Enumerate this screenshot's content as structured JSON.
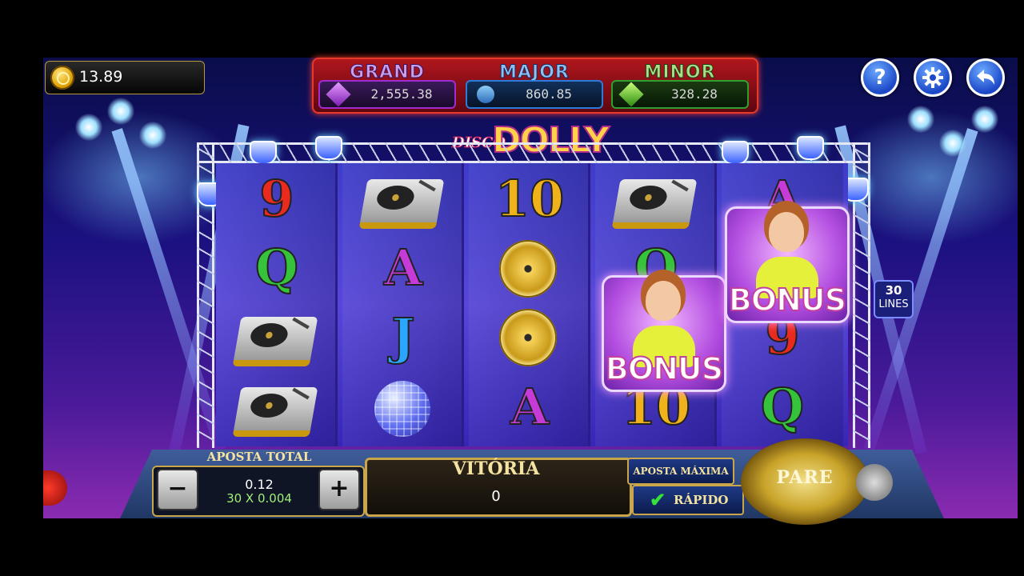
{
  "balance": {
    "value": "13.89",
    "icon": "gold-coin-icon"
  },
  "jackpots": [
    {
      "name": "GRAND",
      "value": "2,555.38",
      "color": "#a22bd0",
      "gem": "purple-gem-icon"
    },
    {
      "name": "MAJOR",
      "value": "860.85",
      "color": "#2b7bd8",
      "gem": "blue-gem-icon"
    },
    {
      "name": "MINOR",
      "value": "328.28",
      "color": "#2fa02f",
      "gem": "green-gem-icon"
    }
  ],
  "header_buttons": {
    "help": "?",
    "settings_icon": "gear-icon",
    "back_icon": "back-arrow-icon"
  },
  "logo": {
    "small": "DISCO",
    "big": "DOLLY"
  },
  "lines": {
    "count": "30",
    "label": "LINES"
  },
  "reels": [
    [
      "9",
      "Q",
      "turntable",
      "turntable"
    ],
    [
      "turntable",
      "A",
      "J",
      "disco-ball"
    ],
    [
      "10",
      "gold-disc",
      "gold-disc",
      "A"
    ],
    [
      "turntable",
      "Q",
      "bonus",
      "10"
    ],
    [
      "A",
      "bonus",
      "9",
      "Q"
    ]
  ],
  "bonus_label": "BONUS",
  "bet": {
    "label": "APOSTA TOTAL",
    "value": "0.12",
    "calc": "30 X 0.004",
    "minus": "−",
    "plus": "+"
  },
  "win": {
    "label": "VITÓRIA",
    "value": "0"
  },
  "buttons": {
    "max_bet": "APOSTA MÁXIMA",
    "fast": "RÁPIDO",
    "fast_check": "✔",
    "spin": "PARE"
  },
  "colors": {
    "letter_9": "#e82a1f",
    "letter_Q": "#36c23a",
    "letter_A": "#c63bd8",
    "letter_J": "#2aa6ff",
    "letter_10": "#f0b21a"
  }
}
